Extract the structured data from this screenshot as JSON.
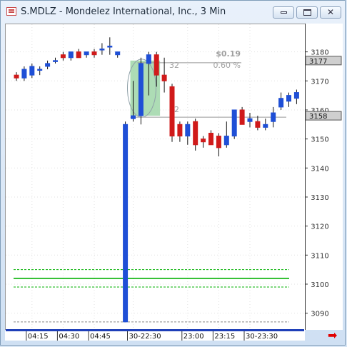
{
  "window": {
    "title": "S.MDLZ - Mondelez International, Inc., 3 Min",
    "controls": {
      "minimize": "▭",
      "maximize": "▢",
      "close": "✕"
    }
  },
  "scroll_arrow": "➡",
  "chart_data": {
    "type": "candlestick",
    "title": "S.MDLZ - Mondelez International, Inc., 3 Min",
    "xlabel": "",
    "ylabel": "",
    "y_tick_labels": [
      "3090",
      "3100",
      "3110",
      "3120",
      "3130",
      "3140",
      "3150",
      "3160",
      "3170",
      "3180"
    ],
    "y_ticks": [
      3090,
      3100,
      3110,
      3120,
      3130,
      3140,
      3150,
      3160,
      3170,
      3180
    ],
    "ylim": [
      3084.5,
      3189.5
    ],
    "x_tick_labels": [
      "04:15",
      "04:30",
      "04:45",
      "30-22:30",
      "23:00",
      "23:15",
      "30-23:30"
    ],
    "x_tick_bar_index": [
      2,
      6,
      10,
      15,
      22,
      26,
      30
    ],
    "price_labels": [
      {
        "value": 3177,
        "label": "3177"
      },
      {
        "value": 3158,
        "label": "3158"
      }
    ],
    "measure_box": {
      "price_change": "$0.19",
      "pct_change": "0.60 %",
      "label_a": "32",
      "label_b": "32",
      "from_price": 3158,
      "to_price": 3177
    },
    "levels": [
      {
        "value": 3102,
        "color": "#00b000",
        "style": "solid"
      },
      {
        "value": 3105,
        "color": "#00b000",
        "style": "dashed"
      },
      {
        "value": 3099,
        "color": "#00b000",
        "style": "dashed"
      },
      {
        "value": 3087,
        "color": "#888888",
        "style": "dashed"
      }
    ],
    "up_color": "#1f4fd6",
    "down_color": "#d01a1a",
    "candles": [
      {
        "o": 3172,
        "h": 3173,
        "l": 3170,
        "c": 3171
      },
      {
        "o": 3171,
        "h": 3175,
        "l": 3170,
        "c": 3174
      },
      {
        "o": 3172,
        "h": 3176,
        "l": 3171,
        "c": 3175
      },
      {
        "o": 3174,
        "h": 3175,
        "l": 3172,
        "c": 3174
      },
      {
        "o": 3175,
        "h": 3177,
        "l": 3174,
        "c": 3176
      },
      {
        "o": 3177,
        "h": 3178,
        "l": 3176,
        "c": 3177
      },
      {
        "o": 3179,
        "h": 3180,
        "l": 3177,
        "c": 3178
      },
      {
        "o": 3178,
        "h": 3180,
        "l": 3177,
        "c": 3180
      },
      {
        "o": 3180,
        "h": 3181,
        "l": 3178,
        "c": 3178
      },
      {
        "o": 3179,
        "h": 3180,
        "l": 3178,
        "c": 3180
      },
      {
        "o": 3180,
        "h": 3181,
        "l": 3178,
        "c": 3179
      },
      {
        "o": 3181,
        "h": 3183,
        "l": 3179,
        "c": 3181
      },
      {
        "o": 3182,
        "h": 3185,
        "l": 3179,
        "c": 3182
      },
      {
        "o": 3179,
        "h": 3180,
        "l": 3178,
        "c": 3180
      },
      {
        "o": 3087,
        "h": 3156,
        "l": 3087,
        "c": 3155
      },
      {
        "o": 3157,
        "h": 3170,
        "l": 3156,
        "c": 3158
      },
      {
        "o": 3158,
        "h": 3178,
        "l": 3155,
        "c": 3176
      },
      {
        "o": 3176,
        "h": 3180,
        "l": 3165,
        "c": 3179
      },
      {
        "o": 3179,
        "h": 3180,
        "l": 3168,
        "c": 3172
      },
      {
        "o": 3172,
        "h": 3178,
        "l": 3166,
        "c": 3170
      },
      {
        "o": 3168,
        "h": 3169,
        "l": 3149,
        "c": 3151
      },
      {
        "o": 3155,
        "h": 3156,
        "l": 3149,
        "c": 3151
      },
      {
        "o": 3151,
        "h": 3156,
        "l": 3148,
        "c": 3155
      },
      {
        "o": 3156,
        "h": 3157,
        "l": 3146,
        "c": 3148
      },
      {
        "o": 3150,
        "h": 3151,
        "l": 3147,
        "c": 3149
      },
      {
        "o": 3152,
        "h": 3153,
        "l": 3148,
        "c": 3148
      },
      {
        "o": 3151,
        "h": 3152,
        "l": 3144,
        "c": 3147
      },
      {
        "o": 3148,
        "h": 3156,
        "l": 3147,
        "c": 3151
      },
      {
        "o": 3151,
        "h": 3160,
        "l": 3150,
        "c": 3160
      },
      {
        "o": 3160,
        "h": 3161,
        "l": 3155,
        "c": 3155
      },
      {
        "o": 3156,
        "h": 3159,
        "l": 3154,
        "c": 3157
      },
      {
        "o": 3156,
        "h": 3158,
        "l": 3153,
        "c": 3154
      },
      {
        "o": 3154,
        "h": 3157,
        "l": 3153,
        "c": 3155
      },
      {
        "o": 3156,
        "h": 3161,
        "l": 3154,
        "c": 3159
      },
      {
        "o": 3161,
        "h": 3166,
        "l": 3160,
        "c": 3164
      },
      {
        "o": 3163,
        "h": 3166,
        "l": 3161,
        "c": 3165
      },
      {
        "o": 3164,
        "h": 3167,
        "l": 3162,
        "c": 3166
      }
    ]
  }
}
